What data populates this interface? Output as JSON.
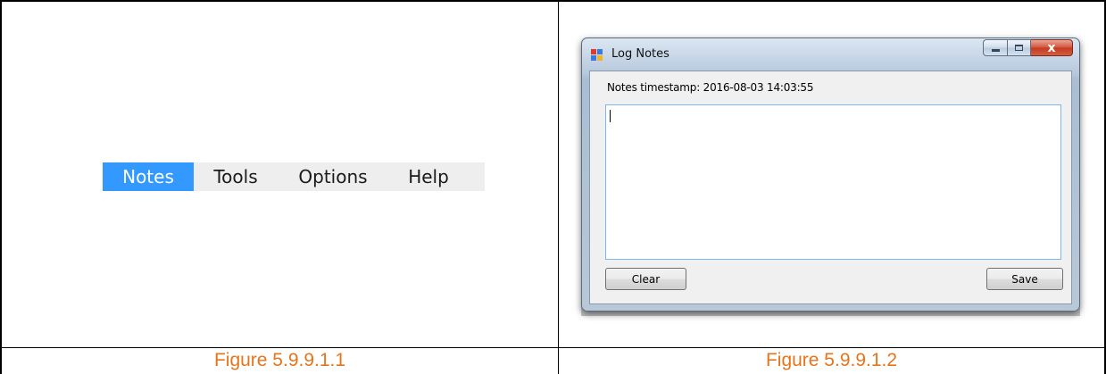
{
  "figures": [
    {
      "caption": "Figure 5.9.9.1.1",
      "menubar": {
        "items": [
          {
            "label": "Notes",
            "active": true
          },
          {
            "label": "Tools",
            "active": false
          },
          {
            "label": "Options",
            "active": false
          },
          {
            "label": "Help",
            "active": false
          }
        ],
        "active_color": "#3399ff"
      }
    },
    {
      "caption": "Figure 5.9.9.1.2",
      "window": {
        "title": "Log Notes",
        "close_glyph": "x",
        "timestamp_text": "Notes timestamp: 2016-08-03 14:03:55",
        "notes_text": "",
        "clear_label": "Clear",
        "save_label": "Save"
      }
    }
  ],
  "colors": {
    "caption": "#e8741a",
    "textbox_border": "#7eb4ea",
    "close_button": "#c23a22"
  },
  "icons": [
    "app-icon",
    "minimize-icon",
    "maximize-icon",
    "close-icon"
  ]
}
